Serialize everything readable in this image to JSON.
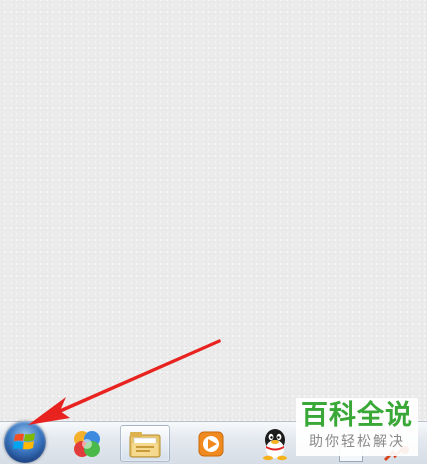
{
  "desktop": {
    "background": "#ececec"
  },
  "taskbar": {
    "start_button": {
      "icon": "windows-logo-icon"
    },
    "pinned": [
      {
        "icon": "color-ball-icon"
      },
      {
        "icon": "folder-explorer-icon"
      },
      {
        "icon": "media-player-icon"
      },
      {
        "icon": "qq-penguin-icon"
      }
    ]
  },
  "watermark": {
    "title": "百科全说",
    "subtitle": "助你轻松解决",
    "color": "#3aa836"
  },
  "annotation": {
    "arrow_color": "#e8231f",
    "target": "start-button"
  }
}
